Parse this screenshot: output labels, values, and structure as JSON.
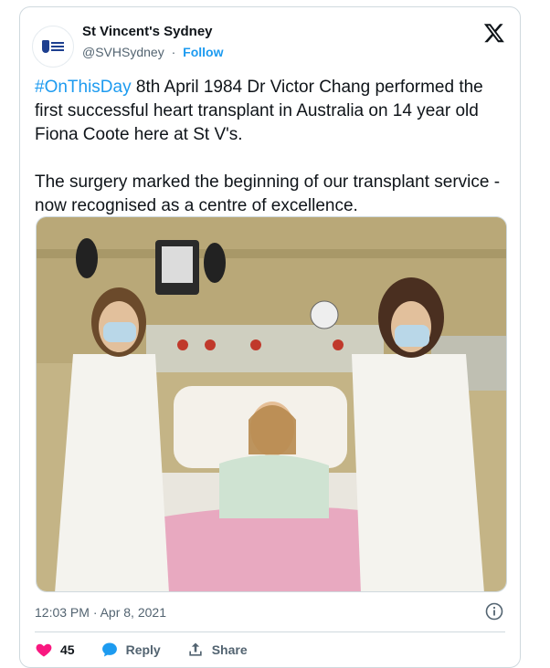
{
  "tweet": {
    "author_name": "St Vincent's Sydney",
    "handle": "@SVHSydney",
    "separator": "·",
    "follow_label": "Follow",
    "hashtag": "#OnThisDay",
    "paragraph1_rest": " 8th April 1984 Dr Victor Chang performed the first successful heart transplant in Australia on 14 year old Fiona Coote here at St V's.",
    "paragraph2": "The surgery marked the beginning of our transplant service - now recognised as a centre of excellence.",
    "timestamp": "12:03 PM · Apr 8, 2021"
  },
  "actions": {
    "like_count": "45",
    "reply_label": "Reply",
    "share_label": "Share"
  },
  "icons": {
    "close": "x-logo-icon",
    "info": "info-icon",
    "like": "heart-icon",
    "reply": "speech-bubble-icon",
    "share": "share-icon"
  },
  "colors": {
    "accent": "#1d9bf0",
    "like": "#f91880",
    "secondary_text": "#536471"
  }
}
